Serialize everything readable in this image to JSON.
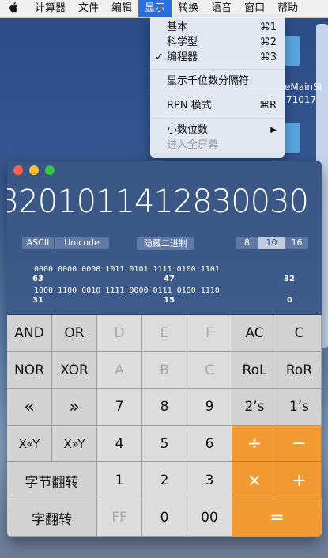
{
  "menubar": {
    "apple": "",
    "items": [
      "计算器",
      "文件",
      "编辑",
      "显示",
      "转换",
      "语音",
      "窗口",
      "帮助"
    ],
    "active_index": 3
  },
  "menu": {
    "items": [
      {
        "check": "",
        "label": "基本",
        "shortcut": "⌘1"
      },
      {
        "check": "",
        "label": "科学型",
        "shortcut": "⌘2"
      },
      {
        "check": "✓",
        "label": "编程器",
        "shortcut": "⌘3"
      },
      {
        "check": "",
        "label": "显示千位数分隔符",
        "shortcut": ""
      },
      {
        "check": "",
        "label": "RPN 模式",
        "shortcut": "⌘R"
      },
      {
        "check": "",
        "label": "小数位数",
        "shortcut": "▶"
      },
      {
        "check": "",
        "label": "进入全屏幕",
        "shortcut": ""
      }
    ]
  },
  "wallpaper": {
    "text1": "eMainSt",
    "text2": "71017"
  },
  "calculator": {
    "display": "3201011412830030",
    "encodings": [
      "ASCII",
      "Unicode"
    ],
    "hide_binary": "隐藏二进制",
    "bases": [
      "8",
      "10",
      "16"
    ],
    "selected_base": "10",
    "bits_row1": "0000 0000 0000 1011 0101 1111 0100 1101",
    "bits_row1_labels": [
      "63",
      "47",
      "32"
    ],
    "bits_row2": "1000 1100 0010 1111 0000 0111 0100 1110",
    "bits_row2_labels": [
      "31",
      "15",
      "0"
    ],
    "keys": {
      "and": "AND",
      "or": "OR",
      "d": "D",
      "e": "E",
      "f": "F",
      "ac": "AC",
      "c": "C",
      "nor": "NOR",
      "xor": "XOR",
      "a": "A",
      "b": "B",
      "c_hex": "C",
      "rol": "RoL",
      "ror": "RoR",
      "shl": "«",
      "shr": "»",
      "seven": "7",
      "eight": "8",
      "nine": "9",
      "twos": "2’s",
      "ones": "1’s",
      "xshly": "X«Y",
      "xshry": "X»Y",
      "four": "4",
      "five": "5",
      "six": "6",
      "divide": "÷",
      "minus": "−",
      "byte_flip": "字节翻转",
      "one": "1",
      "two": "2",
      "three": "3",
      "times": "×",
      "plus": "+",
      "word_flip": "字翻转",
      "ff": "FF",
      "zero": "0",
      "double_zero": "00",
      "equals": "="
    }
  },
  "colors": {
    "accent": "#2c6fe0",
    "operator": "#f39b33",
    "close": "#fc5f57",
    "minimize": "#fdbc2e",
    "zoom": "#33c748"
  }
}
